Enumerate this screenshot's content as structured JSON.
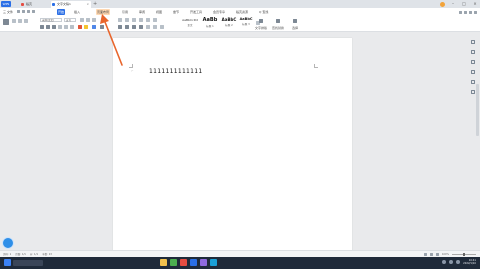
{
  "tabbar": {
    "app_logo": "WPS",
    "tabs": [
      {
        "label": "稻壳",
        "icon": "docer-icon"
      },
      {
        "label": "文字文稿1",
        "icon": "writer-doc-icon"
      }
    ],
    "add_tab": "+",
    "window_controls": [
      "avatar",
      "minimize",
      "maximize",
      "close"
    ]
  },
  "menubar": {
    "left_label": "三 文件",
    "items": [
      "开始",
      "插入",
      "页面布局",
      "引用",
      "审阅",
      "视图",
      "章节",
      "开发工具",
      "会员专享",
      "稻壳资源"
    ],
    "active_item": "开始",
    "highlighted_item": "页面布局",
    "search_label": "Q 查找"
  },
  "ribbon": {
    "font_name": "宋体(正文)",
    "font_size": "五号",
    "styles": [
      {
        "preview": "AaBbCcDd",
        "name": "正文"
      },
      {
        "preview": "AaBb",
        "name": "标题 1"
      },
      {
        "preview": "AaBbC",
        "name": "标题 2"
      },
      {
        "preview": "AaBbC",
        "name": "标题 3"
      }
    ],
    "right_labels": [
      "文字排版",
      "查找替换",
      "选择"
    ]
  },
  "document": {
    "text": "1111111111111"
  },
  "statusbar": {
    "left": [
      "页码: 1",
      "页面: 1/1",
      "节: 1/1",
      "字数: 13"
    ],
    "zoom": "100%"
  },
  "taskbar": {
    "clock_time": "10:41",
    "clock_date": "2022/1/10"
  },
  "colors": {
    "accent": "#2b6fe6",
    "annotation_arrow": "#e8652c"
  }
}
